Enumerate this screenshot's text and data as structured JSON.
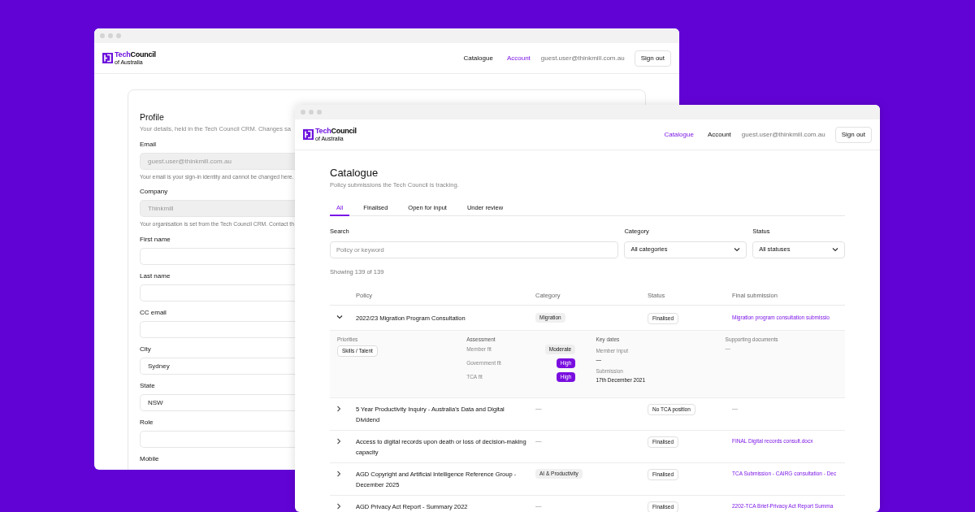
{
  "back_window": {
    "header": {
      "logo": {
        "prefix": "Tech",
        "name": "Council",
        "tagline": "of Australia"
      },
      "nav": [
        {
          "label": "Catalogue",
          "selected": false
        },
        {
          "label": "Account",
          "selected": true
        }
      ],
      "user_email": "guest.user@thinkmill.com.au",
      "sign_out": "Sign out"
    },
    "profile": {
      "title": "Profile",
      "subtitle": "Your details, held in the Tech Council CRM. Changes sa",
      "fields": [
        {
          "label": "Email",
          "value": "guest.user@thinkmill.com.au",
          "disabled": true,
          "help": "Your email is your sign-in identity and cannot be changed here."
        },
        {
          "label": "Company",
          "value": "Thinkmill",
          "disabled": true,
          "help": "Your organisation is set from the Tech Council CRM. Contact th"
        },
        {
          "label": "First name",
          "disabled": false
        },
        {
          "label": "Last name",
          "disabled": false
        },
        {
          "label": "CC email",
          "disabled": false
        },
        {
          "label": "City",
          "value": "Sydney",
          "disabled": false
        },
        {
          "label": "State",
          "value": "NSW",
          "disabled": false
        },
        {
          "label": "Role",
          "disabled": false
        },
        {
          "label": "Mobile"
        }
      ]
    }
  },
  "front_window": {
    "header": {
      "logo": {
        "prefix": "Tech",
        "name": "Council",
        "tagline": "of Australia"
      },
      "nav": [
        {
          "label": "Catalogue",
          "selected": true
        },
        {
          "label": "Account",
          "selected": false
        }
      ],
      "user_email": "guest.user@thinkmill.com.au",
      "sign_out": "Sign out"
    },
    "title": "Catalogue",
    "subtitle": "Policy submissions the Tech Council is tracking.",
    "tabs": [
      {
        "label": "All",
        "selected": true
      },
      {
        "label": "Finalised",
        "selected": false
      },
      {
        "label": "Open for input",
        "selected": false
      },
      {
        "label": "Under review",
        "selected": false
      }
    ],
    "filters": {
      "search": {
        "label": "Search",
        "placeholder": "Policy or keyword"
      },
      "category": {
        "label": "Category",
        "value": "All categories"
      },
      "status": {
        "label": "Status",
        "value": "All statuses"
      }
    },
    "result_count": "Showing 139 of 139",
    "table": {
      "columns": [
        "Policy",
        "Category",
        "Status",
        "Final submission"
      ],
      "rows": [
        {
          "policy": "2022/23 Migration Program Consultation",
          "category": "Migration",
          "status": "Finalised",
          "final_submission": "Migration program consultation submissio",
          "expanded": true,
          "details": {
            "priorities_label": "Priorities",
            "priorities": [
              "Skills / Talent"
            ],
            "assessment_label": "Assessment",
            "assessment": [
              {
                "label": "Member fit",
                "rating": "Moderate",
                "highlighted": false
              },
              {
                "label": "Government fit",
                "rating": "High",
                "highlighted": true
              },
              {
                "label": "TCA fit",
                "rating": "High",
                "highlighted": true
              }
            ],
            "key_dates_label": "Key dates",
            "key_dates": [
              {
                "label": "Member input",
                "value": "—"
              },
              {
                "label": "Submission",
                "value": "17th December 2021"
              }
            ],
            "documents_label": "Supporting documents",
            "documents": "—"
          }
        },
        {
          "policy": "5 Year Productivity Inquiry - Australia's Data and Digital Dividend",
          "category": "—",
          "status": "No TCA position",
          "final_submission": "—",
          "expanded": false
        },
        {
          "policy": "Access to digital records upon death or loss of decision-making capacity",
          "category": "—",
          "status": "Finalised",
          "final_submission": "FINAL Digital records consult.docx",
          "expanded": false
        },
        {
          "policy": "AGD Copyright and Artificial Intelligence Reference Group - December 2025",
          "category": "AI & Productivity",
          "status": "Finalised",
          "final_submission": "TCA Submission - CAIRG consultation - Dec",
          "expanded": false
        },
        {
          "policy": "AGD Privacy Act Report - Summary 2022",
          "category": "—",
          "status": "Finalised",
          "final_submission": "2202-TCA Brief-Privacy Act Report Summa",
          "expanded": false
        }
      ]
    }
  }
}
